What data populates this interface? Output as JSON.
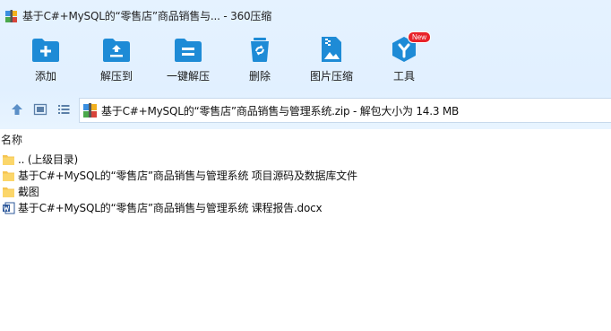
{
  "window": {
    "title": "基于C#+MySQL的“零售店”商品销售与... - 360压缩"
  },
  "toolbar": {
    "items": [
      {
        "label": "添加",
        "icon": "add-archive-icon"
      },
      {
        "label": "解压到",
        "icon": "extract-to-icon"
      },
      {
        "label": "一键解压",
        "icon": "one-click-extract-icon"
      },
      {
        "label": "删除",
        "icon": "delete-icon"
      },
      {
        "label": "图片压缩",
        "icon": "image-compress-icon"
      },
      {
        "label": "工具",
        "icon": "tools-icon",
        "badge": "New"
      }
    ]
  },
  "address": {
    "path": "基于C#+MySQL的“零售店”商品销售与管理系统.zip - 解包大小为 14.3 MB"
  },
  "list": {
    "column_name": "名称",
    "items": [
      {
        "name": ".. (上级目录)",
        "type": "folder"
      },
      {
        "name": "基于C#+MySQL的“零售店”商品销售与管理系统 项目源码及数据库文件",
        "type": "folder"
      },
      {
        "name": "截图",
        "type": "folder"
      },
      {
        "name": "基于C#+MySQL的“零售店”商品销售与管理系统 课程报告.docx",
        "type": "word-document"
      }
    ]
  },
  "colors": {
    "accent": "#1e8bd6",
    "toolbar_bg": "#e3f1ff",
    "folder": "#f5c451",
    "badge": "#e8232b"
  }
}
